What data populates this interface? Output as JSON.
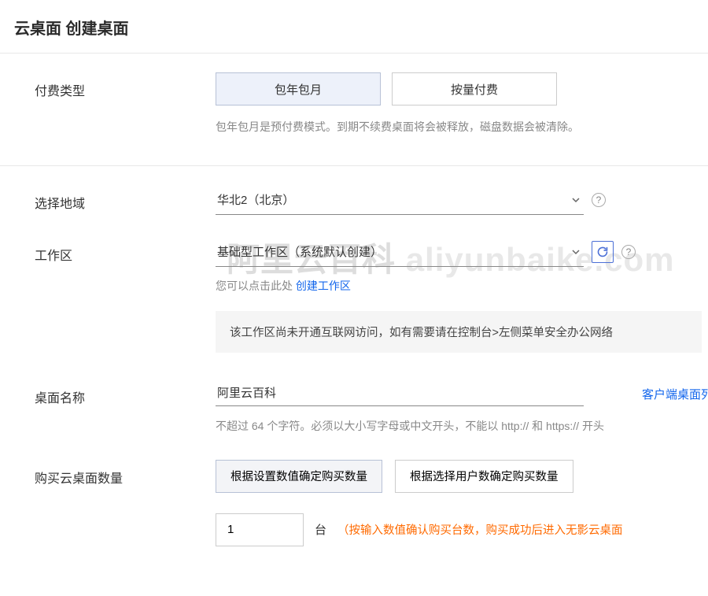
{
  "page": {
    "title": "云桌面 创建桌面"
  },
  "watermark": {
    "cn": "阿里云百科",
    "en": "aliyunbaike.com"
  },
  "billing": {
    "label": "付费类型",
    "options": [
      "包年包月",
      "按量付费"
    ],
    "hint": "包年包月是预付费模式。到期不续费桌面将会被释放，磁盘数据会被清除。"
  },
  "region": {
    "label": "选择地域",
    "value": "华北2（北京）"
  },
  "workspace": {
    "label": "工作区",
    "value": "基础型工作区（系统默认创建）",
    "hint_prefix": "您可以点击此处 ",
    "create_link": "创建工作区",
    "alert": "该工作区尚未开通互联网访问，如有需要请在控制台>左侧菜单安全办公网络"
  },
  "name": {
    "label": "桌面名称",
    "value": "阿里云百科",
    "side_link": "客户端桌面列表示",
    "hint": "不超过 64 个字符。必须以大小写字母或中文开头，不能以 http:// 和 https:// 开头"
  },
  "quantity": {
    "label": "购买云桌面数量",
    "options": [
      "根据设置数值确定购买数量",
      "根据选择用户数确定购买数量"
    ],
    "value": "1",
    "unit": "台",
    "warn": "（按输入数值确认购买台数，购买成功后进入无影云桌面"
  }
}
